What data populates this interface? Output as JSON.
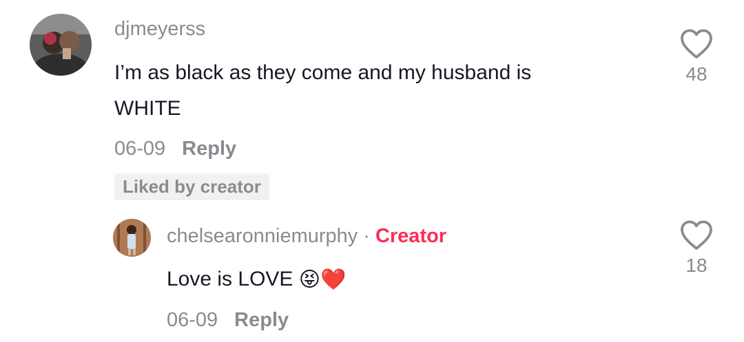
{
  "comments": [
    {
      "username": "djmeyerss",
      "text_line1": "I’m as black as they come and my husband is",
      "text_line2": "WHITE",
      "date": "06-09",
      "reply_label": "Reply",
      "liked_badge": "Liked by creator",
      "like_count": "48",
      "icon": "heart-outline-icon"
    }
  ],
  "replies": [
    {
      "username": "chelsearonniemurphy",
      "separator": "·",
      "creator_label": "Creator",
      "text": "Love is LOVE",
      "emojis": [
        "😝",
        "❤️"
      ],
      "date": "06-09",
      "reply_label": "Reply",
      "like_count": "18",
      "icon": "heart-outline-icon"
    }
  ],
  "colors": {
    "secondary_text": "#8a8b91",
    "primary_text": "#161823",
    "creator_accent": "#fe2c55",
    "badge_bg": "#f1f1f2"
  }
}
